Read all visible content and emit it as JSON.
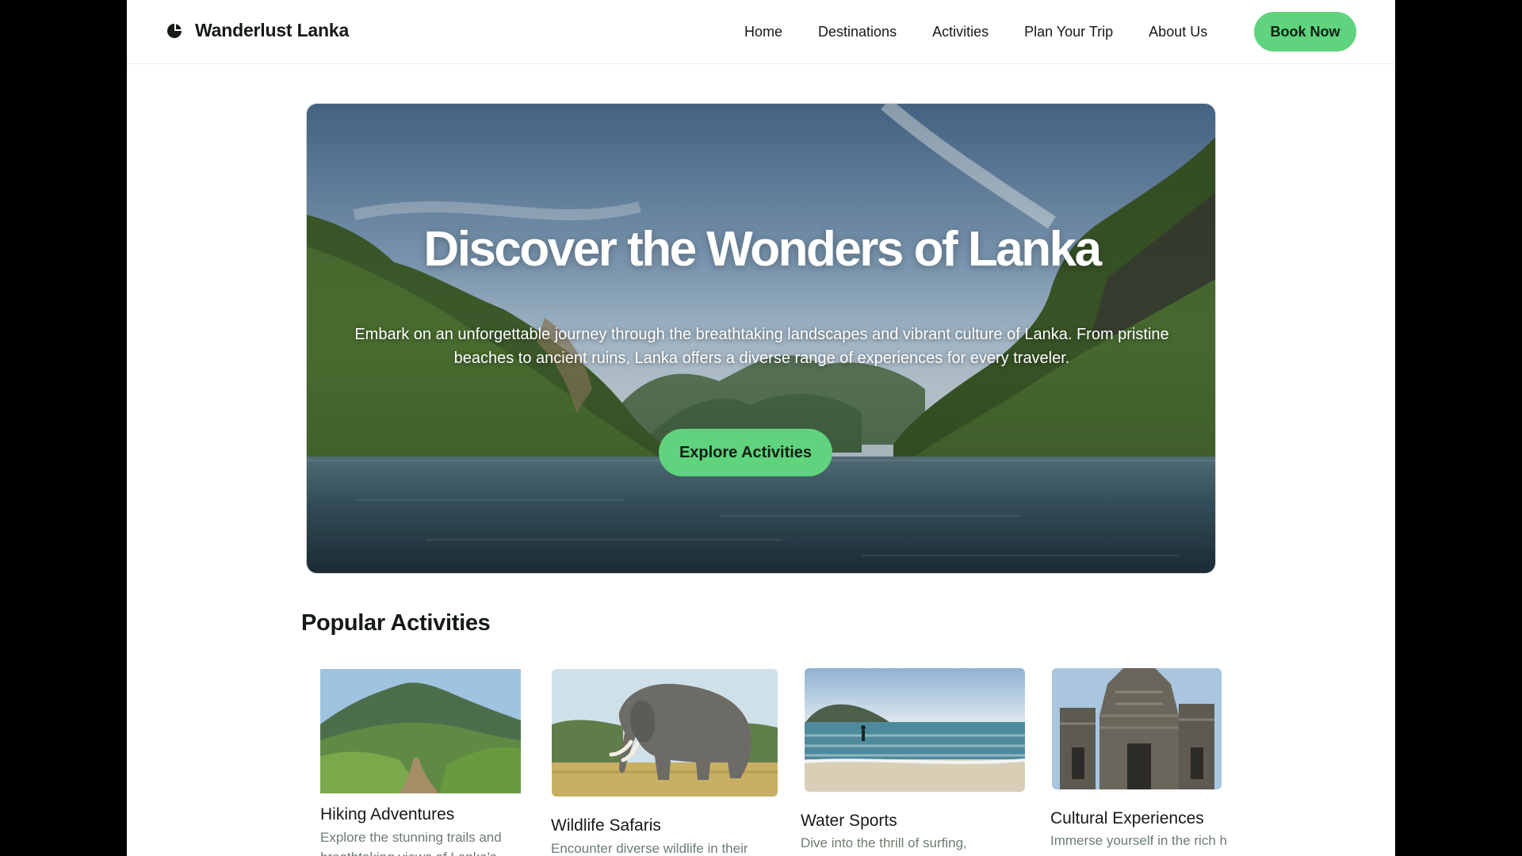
{
  "brand": {
    "name": "Wanderlust Lanka",
    "logo_icon": "logo-mark-icon"
  },
  "nav": {
    "items": [
      "Home",
      "Destinations",
      "Activities",
      "Plan Your Trip",
      "About Us"
    ],
    "cta": "Book Now"
  },
  "hero": {
    "title": "Discover the Wonders of Lanka",
    "description": "Embark on an unforgettable journey through the breathtaking landscapes and vibrant culture of Lanka. From pristine beaches to ancient ruins, Lanka offers a diverse range of experiences for every traveler.",
    "cta": "Explore Activities",
    "image": "lake-with-forested-hills"
  },
  "activities": {
    "title": "Popular Activities",
    "items": [
      {
        "title": "Hiking Adventures",
        "description": "Explore the stunning trails and breathtaking views of Lanka's",
        "image": "mountain-trail"
      },
      {
        "title": "Wildlife Safaris",
        "description": "Encounter diverse wildlife in their",
        "image": "elephant"
      },
      {
        "title": "Water Sports",
        "description": "Dive into the thrill of surfing,",
        "image": "beach-surfer"
      },
      {
        "title": "Cultural Experiences",
        "description": "Immerse yourself in the rich h",
        "image": "ancient-temple"
      }
    ]
  },
  "colors": {
    "accent": "#5fd37d",
    "text": "#141a14",
    "muted": "#6b7d6f",
    "page_bg": "#ffffff",
    "frame": "#000000"
  }
}
